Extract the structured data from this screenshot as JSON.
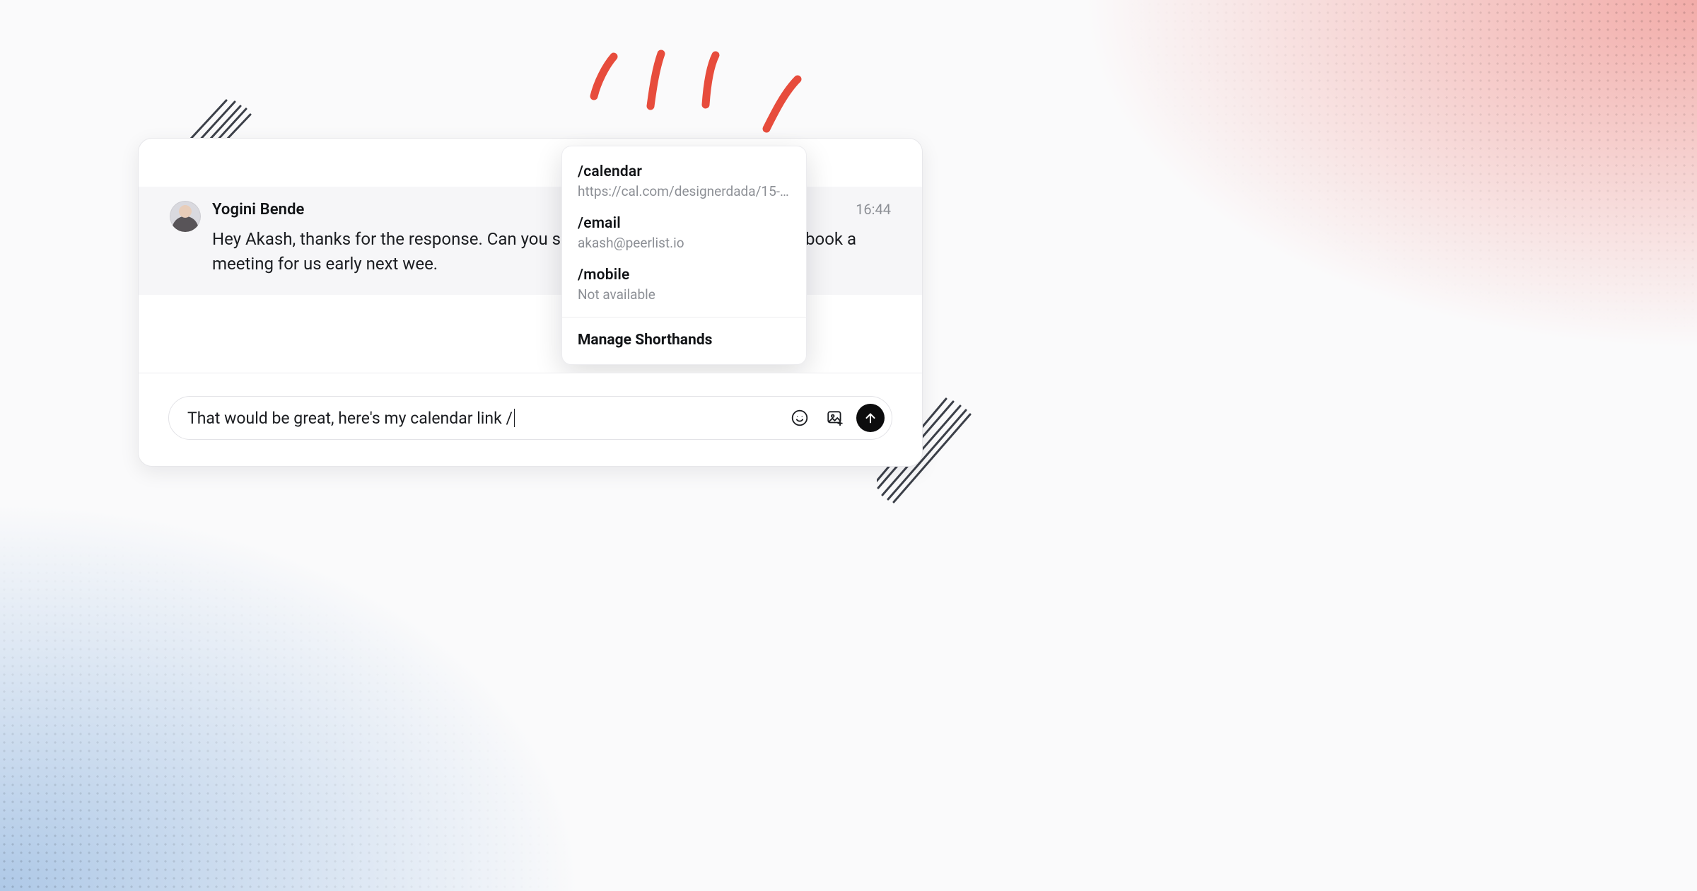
{
  "message": {
    "sender": "Yogini Bende",
    "time": "16:44",
    "body": "Hey Akash, thanks for the response. Can you share your calendar link and I will book a meeting for us early next wee."
  },
  "shorthands": {
    "items": [
      {
        "command": "/calendar",
        "value": "https://cal.com/designerdada/15-…"
      },
      {
        "command": "/email",
        "value": "akash@peerlist.io"
      },
      {
        "command": "/mobile",
        "value": "Not available"
      }
    ],
    "manage_label": "Manage Shorthands"
  },
  "composer": {
    "text": "That would be great, here's my calendar link /"
  }
}
